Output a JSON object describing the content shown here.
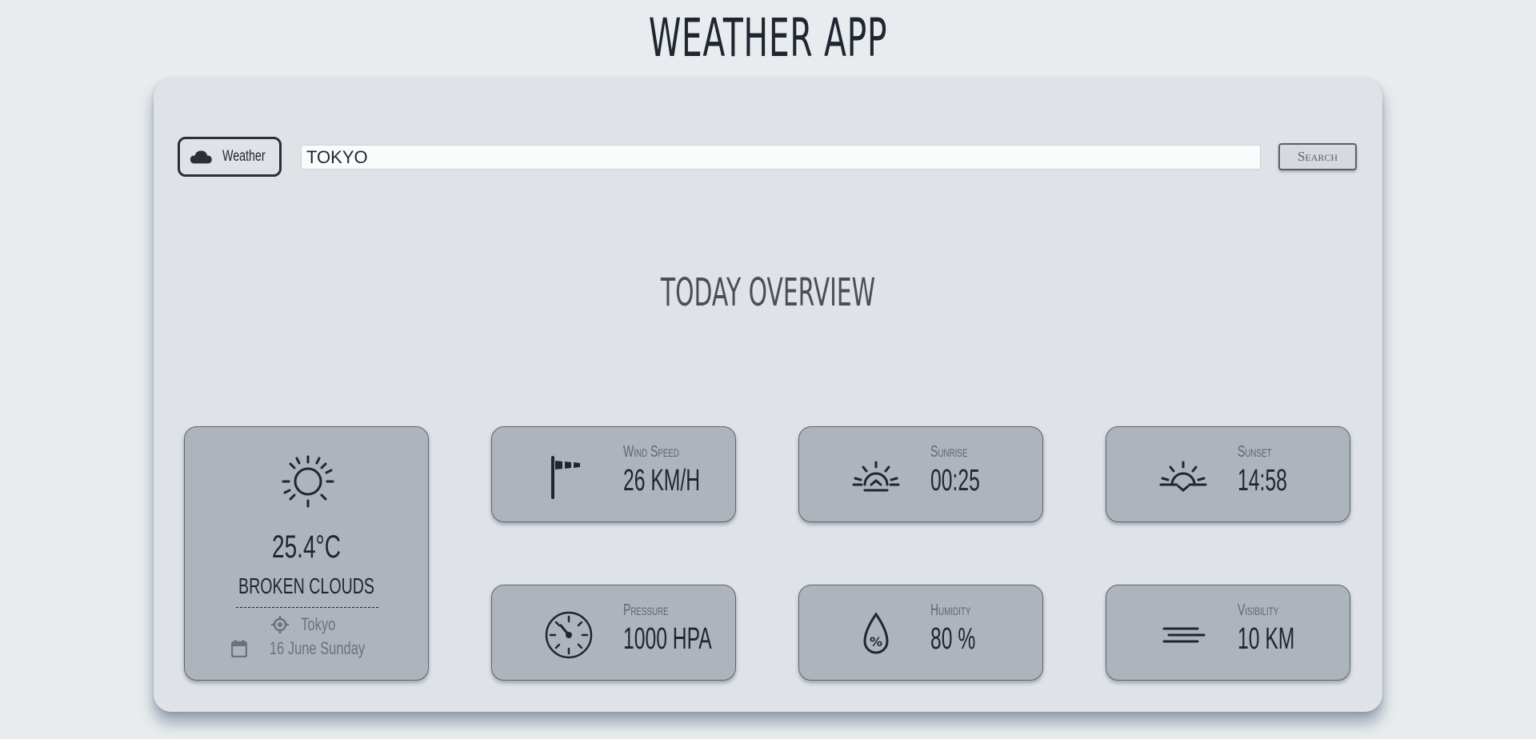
{
  "app_title": "WEATHER APP",
  "search": {
    "brand_label": "Weather",
    "input_value": "TOKYO",
    "button_label": "Search"
  },
  "overview_title": "TODAY OVERVIEW",
  "current": {
    "temperature": "25.4°C",
    "description": "BROKEN CLOUDS",
    "location": "Tokyo",
    "date": "16 June Sunday",
    "icon": "sun-icon"
  },
  "stats": {
    "wind": {
      "label": "Wind Speed",
      "value": "26 KM/H",
      "icon": "windsock-icon"
    },
    "sunrise": {
      "label": "Sunrise",
      "value": "00:25",
      "icon": "sunrise-icon"
    },
    "sunset": {
      "label": "Sunset",
      "value": "14:58",
      "icon": "sunset-icon"
    },
    "pressure": {
      "label": "Pressure",
      "value": "1000 HPA",
      "icon": "gauge-icon"
    },
    "humidity": {
      "label": "Humidity",
      "value": "80 %",
      "icon": "humidity-drop-icon"
    },
    "visibility": {
      "label": "Visibility",
      "value": "10 KM",
      "icon": "fog-lines-icon"
    }
  },
  "colors": {
    "page_bg": "#e8ecef",
    "card_bg": "#dfe2e6",
    "tile_bg": "#adb4bc",
    "text_dark": "#1f2630"
  }
}
